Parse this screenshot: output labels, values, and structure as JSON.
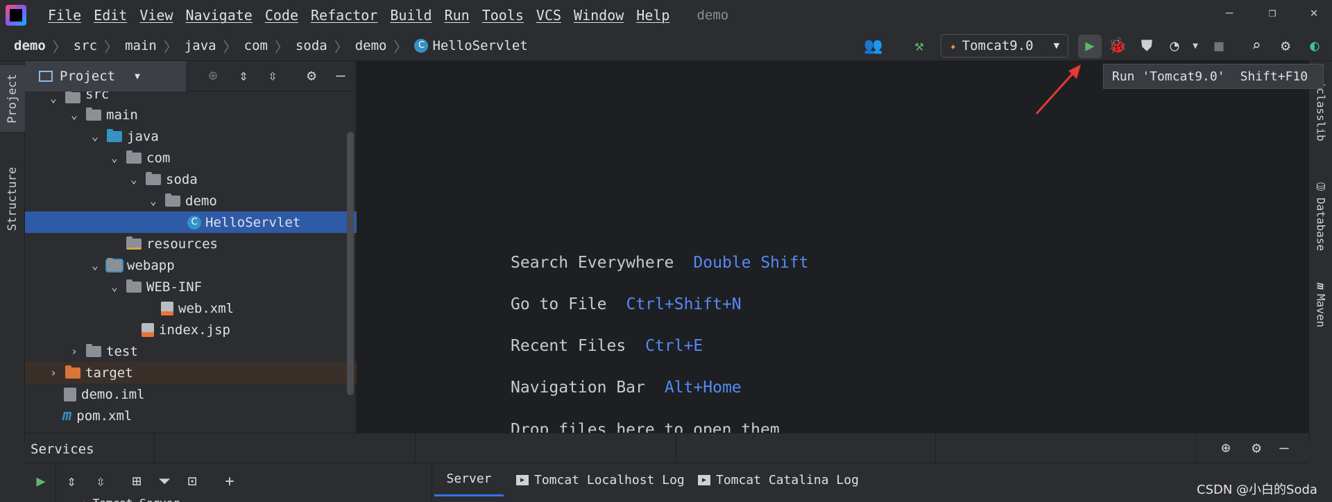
{
  "menubar": {
    "items": [
      "File",
      "Edit",
      "View",
      "Navigate",
      "Code",
      "Refactor",
      "Build",
      "Run",
      "Tools",
      "VCS",
      "Window",
      "Help"
    ],
    "project_name": "demo"
  },
  "breadcrumb": {
    "items": [
      "demo",
      "src",
      "main",
      "java",
      "com",
      "soda",
      "demo"
    ],
    "file": "HelloServlet"
  },
  "toolbar": {
    "run_config": "Tomcat9.0",
    "tooltip_text": "Run 'Tomcat9.0'",
    "tooltip_shortcut": "Shift+F10"
  },
  "left_strip": {
    "project_tab": "Project",
    "structure_tab": "Structure"
  },
  "project_panel": {
    "title": "Project",
    "tree": [
      {
        "label": "src",
        "type": "folder",
        "expanded": true
      },
      {
        "label": "main",
        "type": "folder",
        "expanded": true
      },
      {
        "label": "java",
        "type": "source-folder",
        "expanded": true
      },
      {
        "label": "com",
        "type": "package",
        "expanded": true
      },
      {
        "label": "soda",
        "type": "package",
        "expanded": true
      },
      {
        "label": "demo",
        "type": "package",
        "expanded": true
      },
      {
        "label": "HelloServlet",
        "type": "class",
        "selected": true
      },
      {
        "label": "resources",
        "type": "resources-folder"
      },
      {
        "label": "webapp",
        "type": "web-folder",
        "expanded": true
      },
      {
        "label": "WEB-INF",
        "type": "folder",
        "expanded": true
      },
      {
        "label": "web.xml",
        "type": "xml-file"
      },
      {
        "label": "index.jsp",
        "type": "jsp-file"
      },
      {
        "label": "test",
        "type": "folder",
        "expanded": false
      },
      {
        "label": "target",
        "type": "excluded-folder",
        "expanded": false
      },
      {
        "label": "demo.iml",
        "type": "iml-file"
      },
      {
        "label": "pom.xml",
        "type": "maven-file"
      }
    ]
  },
  "editor": {
    "hints": [
      {
        "action": "Search Everywhere",
        "key": "Double Shift"
      },
      {
        "action": "Go to File",
        "key": "Ctrl+Shift+N"
      },
      {
        "action": "Recent Files",
        "key": "Ctrl+E"
      },
      {
        "action": "Navigation Bar",
        "key": "Alt+Home"
      },
      {
        "action": "Drop files here to open them",
        "key": ""
      }
    ]
  },
  "right_strip": {
    "tabs": [
      "jclasslib",
      "Database",
      "Maven"
    ]
  },
  "services": {
    "title": "Services",
    "tabs": [
      "Server",
      "Tomcat Localhost Log",
      "Tomcat Catalina Log"
    ],
    "tree_first": "Tomcat Server"
  },
  "watermark": "CSDN @小白的Soda",
  "colors": {
    "background": "#2b2d30",
    "editor_bg": "#1e1f22",
    "selection": "#2e5aa8",
    "shortcut_blue": "#548af7",
    "run_green": "#5fb865",
    "arrow_red": "#e53935"
  }
}
